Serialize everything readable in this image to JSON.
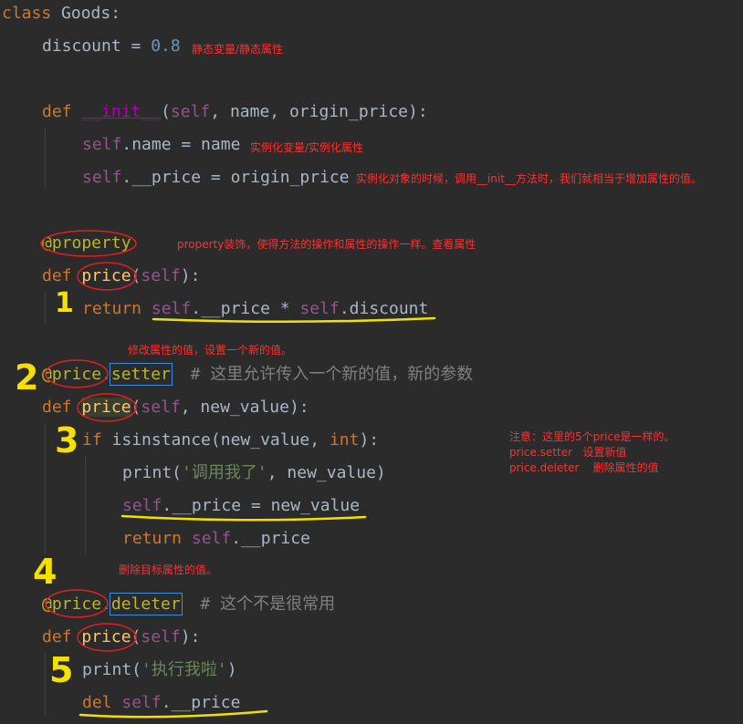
{
  "code": {
    "l1_class": "class",
    "l1_name": " Goods:",
    "l2_var": "discount",
    "l2_eq": " = ",
    "l2_val": "0.8",
    "l4_def": "def",
    "l4_init": "__init__",
    "l4_open": "(",
    "l4_self": "self",
    "l4_rest": ", name, origin_price):",
    "l5_self": "self",
    "l5_rest": ".name = name",
    "l6_self": "self",
    "l6_rest": ".__price = origin_price",
    "l8_dec": "@property",
    "l9_def": "def",
    "l9_fn": "price",
    "l9_open": "(",
    "l9_self": "self",
    "l9_close": "):",
    "l10_ret": "return",
    "l10_self1": "self",
    "l10_mid": ".__price * ",
    "l10_self2": "self",
    "l10_end": ".discount",
    "l12_at": "@",
    "l12_price": "price",
    "l12_dot": ".",
    "l12_setter": "setter",
    "l12_com": "  # 这里允许传入一个新的值，新的参数",
    "l13_def": "def",
    "l13_fn": "price",
    "l13_open": "(",
    "l13_self": "self",
    "l13_rest": ", new_value):",
    "l14_if": "if",
    "l14_mid": " isinstance(new_value, ",
    "l14_int": "int",
    "l14_end": "):",
    "l15_print": "print(",
    "l15_str": "'调用我了'",
    "l15_end": ", new_value)",
    "l16_self": "self",
    "l16_rest": ".__price = new_value",
    "l17_ret": "return",
    "l17_self": "self",
    "l17_rest": ".__price",
    "l19_at": "@",
    "l19_price": "price",
    "l19_dot": ".",
    "l19_deleter": "deleter",
    "l19_com": "  # 这个不是很常用",
    "l20_def": "def",
    "l20_fn": "price",
    "l20_open": "(",
    "l20_self": "self",
    "l20_close": "):",
    "l21_print": "print(",
    "l21_str": "'执行我啦'",
    "l21_end": ")",
    "l22_del": "del",
    "l22_self": "self",
    "l22_rest": ".__price"
  },
  "notes": {
    "static": "静态变量/静态属性",
    "instance": "实例化变量/实例化属性",
    "init": "实例化对象的时候，调用__init__方法时，我们就相当于增加属性的值。",
    "property": "property装饰，使得方法的操作和属性的操作一样。查看属性",
    "modify": "修改属性的值，设置一个新的值。",
    "same_1": "注意：这里的5个price是一样的。",
    "same_2": "price.setter   设置新值",
    "same_3": "price.deleter    删除属性的值",
    "delete": "删除目标属性的值。"
  },
  "marks": [
    "1",
    "2",
    "3",
    "4",
    "5"
  ],
  "colors": {
    "background": "#2b2b2b",
    "keyword": "#cc7832",
    "self": "#94558d",
    "number": "#6897bb",
    "string": "#6a8759",
    "decorator": "#bbb529",
    "comment": "#808080",
    "annotation": "#ff3030",
    "marker": "#f5e000",
    "circle": "#e02020"
  }
}
